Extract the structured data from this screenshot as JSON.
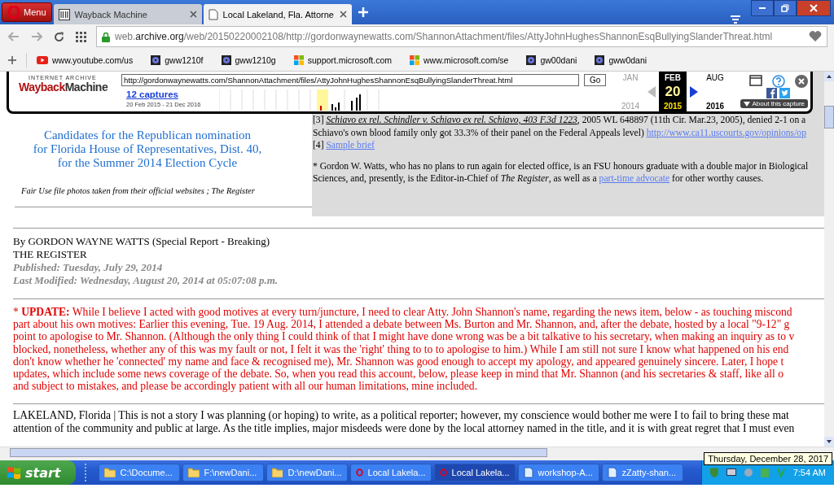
{
  "browser": {
    "menu_label": "Menu",
    "tabs": [
      {
        "title": "Wayback Machine",
        "selected": false
      },
      {
        "title": "Local Lakeland, Fla. Attorne",
        "selected": true
      }
    ],
    "url": {
      "prefix": "web.",
      "domain": "archive.org",
      "path": "/web/20150220002108/http://gordonwaynewatts.com/ShannonAttachment/files/AttyJohnHughesShannonEsqBullyingSlanderThreat.html"
    },
    "bookmarks": [
      "www.youtube.com/us",
      "gww1210f",
      "gww1210g",
      "support.microsoft.com",
      "www.microsoft.com/se",
      "gw00dani",
      "gww0dani"
    ]
  },
  "wayback": {
    "logo_top": "INTERNET ARCHIVE",
    "logo_left": "Wayback",
    "logo_right": "Machine",
    "url_input": "http://gordonwaynewatts.com/ShannonAttachment/files/AttyJohnHughesShannonEsqBullyingSlanderThreat.html",
    "go": "Go",
    "captures": "12 captures",
    "range": "20 Feb 2015 - 21 Dec 2016",
    "calendar": [
      {
        "month": "JAN",
        "year": "2014",
        "selected": false
      },
      {
        "month": "FEB",
        "day": "20",
        "year": "2015",
        "selected": true
      },
      {
        "month": "AUG",
        "year": "2016",
        "selected": false
      }
    ],
    "about": "About this capture"
  },
  "page": {
    "heading": [
      "Candidates for the Republican nomination",
      "for Florida House of Representatives, Dist. 40,",
      "for the Summer 2014 Election Cycle"
    ],
    "caption": "Fair Use file photos taken from their official websites ; The Register",
    "notes": [
      [
        {
          "text": "[3] "
        },
        {
          "text": "Schiavo ex rel. Schindler v. Schiavo ex rel. Schiavo, 403 F.3d 1223",
          "kind": "cite"
        },
        {
          "text": ", 2005 WL 648897 (11th Cir. Mar.23, 2005), denied 2-1 on a"
        }
      ],
      [
        {
          "text": "Schiavo's own blood family only got 33.3% of their panel on the Federal Appeals level) "
        },
        {
          "text": "http://www.ca11.uscourts.gov/opinions/op",
          "kind": "link"
        }
      ],
      [
        {
          "text": "[4] "
        },
        {
          "text": "Sample brief",
          "kind": "link"
        }
      ],
      [
        {
          "text": "* Gordon W. Watts, who has no plans to run again for elected office, is an FSU honours graduate with a double major in Biological"
        }
      ],
      [
        {
          "text": "Sciences, and, presently, is the Editor-in-Chief of *The Register*, as well as a "
        },
        {
          "text": "part-time advocate",
          "kind": "link"
        },
        {
          "text": " for other worthy causes."
        }
      ]
    ],
    "byline": [
      "By GORDON WAYNE WATTS (Special Report - Breaking)",
      "THE REGISTER"
    ],
    "published": "Published: Tuesday, July 29, 2014",
    "modified": "Last Modified: Wednesday, August 20, 2014 at 05:07:08 p.m.",
    "update": [
      "* **UPDATE:** While I believe I acted with good motives at every turn/juncture, I need to clear Atty. John Shannon's name, regarding the news item, below - as touching miscond",
      "part about his own motives: Earlier this evening, Tue. 19 Aug. 2014, I attended a debate between Ms. Burton and Mr. Shannon, and, after the debate, hosted by a local \"9-12\" g",
      "point to apologise to Mr. Shannon. (Although the only thing I could think of that I might have done wrong was be a bit talkative to his secretary, when making an inquiry as to v",
      "blocked, nonetheless, whether any of this was my fault or not, I felt it was the 'right' thing to to to apologise to him.) While I am still not sure I know what happened on his end",
      "don't know whether he 'connected' my name and face & recognised me), Mr. Shannon was good enough to accept my apology, and appeared genuinely sincere. Later, I hope t",
      "updates, which include some news coverage of the debate. So, when you read this account, below, please keep in mind that Mr. Shannon (and his secretaries & staff, like all o",
      "and subject to mistakes, and please be accordingly patient with all our human limitations, mine included."
    ],
    "body": [
      "LAKELAND, Florida | This is not a story I was planning (or hoping) to write, as a political reporter; however, my conscience would bother me were I to fail to bring these mat",
      "attention of the community and public at large. As the title implies, major misdeeds were done by the local attorney named in the title, and it is with great regret that I must even"
    ]
  },
  "tooltip": "Thursday, December 28, 2017",
  "taskbar": {
    "start": "start",
    "items": [
      {
        "label": "C:\\Docume...",
        "selected": false
      },
      {
        "label": "F:\\newDani...",
        "selected": false
      },
      {
        "label": "D:\\newDani...",
        "selected": false
      },
      {
        "label": "Local Lakela...",
        "selected": false
      },
      {
        "label": "Local Lakela...",
        "selected": true
      },
      {
        "label": "workshop-A...",
        "selected": false
      },
      {
        "label": "zZatty-shan...",
        "selected": false
      }
    ],
    "clock": "7:54 AM"
  }
}
